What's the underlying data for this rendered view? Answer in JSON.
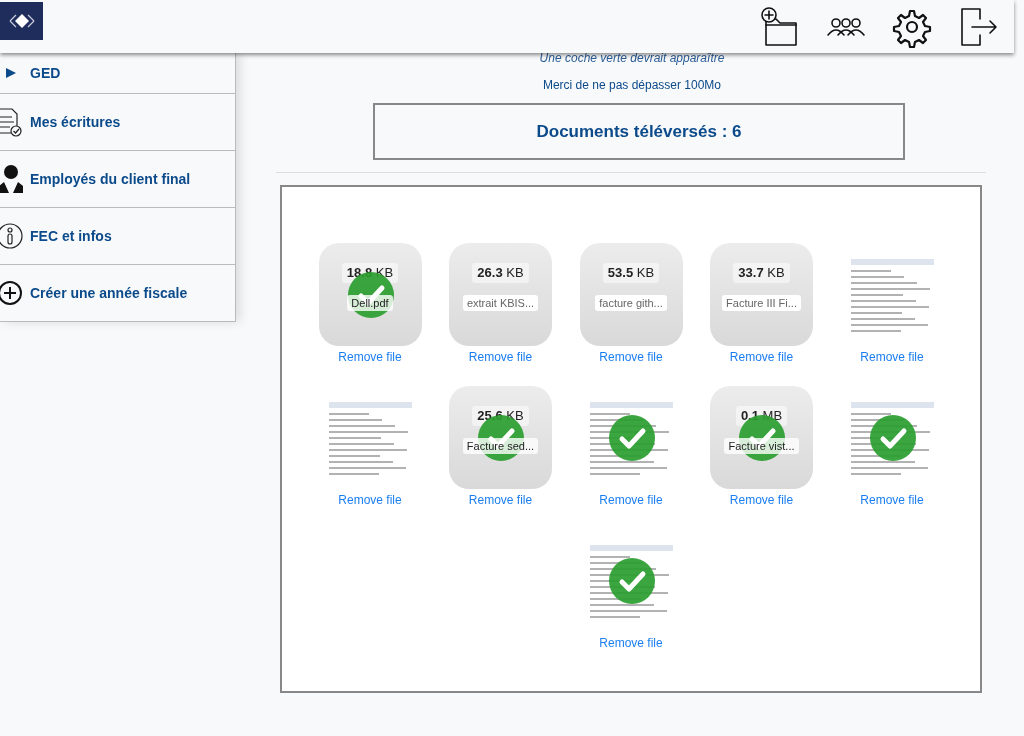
{
  "sidebar": {
    "items": [
      {
        "label": "GED"
      },
      {
        "label": "Mes écritures"
      },
      {
        "label": "Employés du client final"
      },
      {
        "label": "FEC et infos"
      },
      {
        "label": "Créer une année fiscale"
      }
    ]
  },
  "notice": {
    "hint": "Une coche verte devrait apparaître",
    "limit": "Merci de ne pas dépasser 100Mo"
  },
  "counter": "Documents téléversés : 6",
  "files": [
    {
      "kind": "generic",
      "size": "**18.8** KB",
      "name": "Dell.pdf",
      "uploaded": true,
      "remove": "Remove file"
    },
    {
      "kind": "generic",
      "size": "**26.3** KB",
      "name": "extrait KBIS...",
      "uploaded": false,
      "remove": "Remove file"
    },
    {
      "kind": "generic",
      "size": "**53.5** KB",
      "name": "facture gith...",
      "uploaded": false,
      "remove": "Remove file"
    },
    {
      "kind": "generic",
      "size": "**33.7** KB",
      "name": "Facture III Fi...",
      "uploaded": false,
      "remove": "Remove file"
    },
    {
      "kind": "preview",
      "uploaded": false,
      "remove": "Remove file"
    },
    {
      "kind": "preview",
      "uploaded": false,
      "remove": "Remove file"
    },
    {
      "kind": "generic",
      "size": "**25.6** KB",
      "name": "Facture sed...",
      "uploaded": true,
      "remove": "Remove file"
    },
    {
      "kind": "preview",
      "uploaded": true,
      "remove": "Remove file"
    },
    {
      "kind": "generic",
      "size": "**0.1** MB",
      "name": "Facture vist...",
      "uploaded": true,
      "remove": "Remove file"
    },
    {
      "kind": "preview",
      "uploaded": true,
      "remove": "Remove file"
    },
    {
      "kind": "preview",
      "uploaded": true,
      "remove": "Remove file"
    }
  ]
}
